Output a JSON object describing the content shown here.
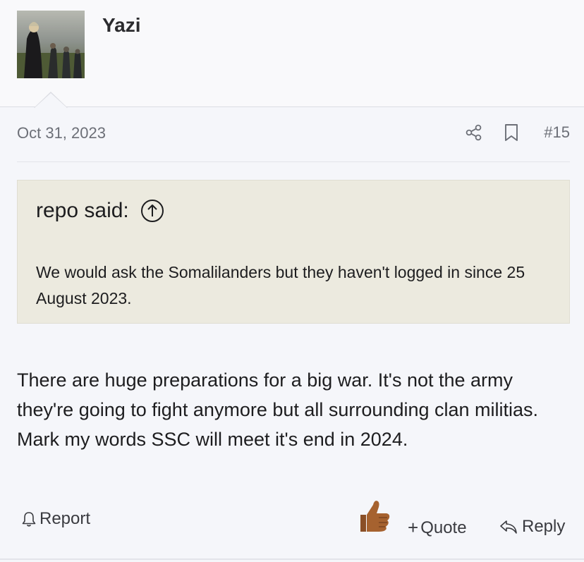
{
  "user": {
    "name": "Yazi"
  },
  "post": {
    "date": "Oct 31, 2023",
    "number": "#15",
    "body": "There are huge preparations for a big war. It's not the army they're going to fight anymore but all surrounding clan militias. Mark my words SSC will meet it's end in 2024."
  },
  "quote": {
    "header": "repo said:",
    "text": "We would ask the Somalilanders but they haven't logged in since 25 August 2023."
  },
  "actions": {
    "report_label": "Report",
    "quote_label": "Quote",
    "quote_prefix": "+",
    "reply_label": "Reply"
  },
  "icons": {
    "avatar": "avatar-image",
    "share": "share-icon",
    "bookmark": "bookmark-icon",
    "goto": "arrow-up-circle-icon",
    "report": "bell-icon",
    "like": "thumbs-up-icon",
    "reply": "reply-icon"
  },
  "colors": {
    "background": "#f5f6fa",
    "quote_background": "#eceadf",
    "muted_text": "#6c6f77",
    "thumb": "#9a5a2e"
  }
}
